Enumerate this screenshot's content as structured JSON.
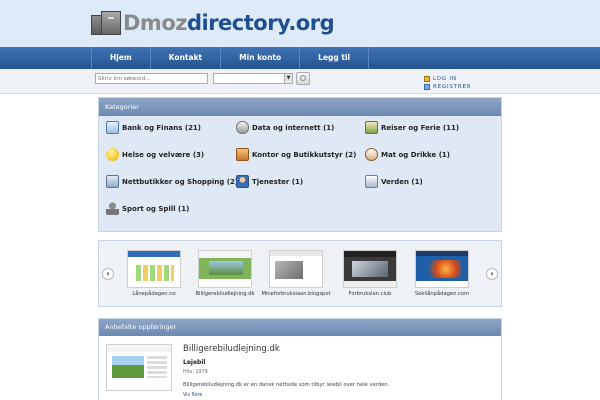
{
  "logo": {
    "part1": "Dmoz",
    "part2": "directory.org"
  },
  "nav": {
    "items": [
      "Hjem",
      "Kontakt",
      "Min konto",
      "Legg til"
    ]
  },
  "search": {
    "placeholder": "Skriv inn søkeord..."
  },
  "account": {
    "login": "LOG IN",
    "register": "REGISTRER"
  },
  "categories": {
    "heading": "Kategorier",
    "items": [
      {
        "label": "Bank og Finans (21)",
        "icon": "bank-icon"
      },
      {
        "label": "Data og internett (1)",
        "icon": "computer-mouse-icon"
      },
      {
        "label": "Reiser og Ferie (11)",
        "icon": "travel-icon"
      },
      {
        "label": "Helse og velvære (3)",
        "icon": "smiley-icon"
      },
      {
        "label": "Kontor og Butikkutstyr (2)",
        "icon": "office-box-icon"
      },
      {
        "label": "Mat og Drikke (1)",
        "icon": "coffee-cup-icon"
      },
      {
        "label": "Nettbutikker og Shopping (2)",
        "icon": "shopping-basket-icon"
      },
      {
        "label": "Tjenester (1)",
        "icon": "person-icon"
      },
      {
        "label": "Verden (1)",
        "icon": "building-icon"
      },
      {
        "label": "Sport og Spill (1)",
        "icon": "trophy-icon"
      }
    ]
  },
  "carousel": {
    "items": [
      {
        "label": "Lånepådagen.no"
      },
      {
        "label": "Billigerebiludlejning.dk"
      },
      {
        "label": "Mineforbrukslaan.blogspot"
      },
      {
        "label": "Forbrukslan.club"
      },
      {
        "label": "Sekilånpådagen.com"
      }
    ]
  },
  "featured": {
    "heading": "Anbefalte oppføringer",
    "title": "Billigerebiludlejning.dk",
    "subtitle": "Lejebil",
    "small": "Hits: 1979",
    "description": "Billigerebiludlejning.dk er en dansk nettside som tilbyr leiebil over hele verden.",
    "link": "Vis flere"
  },
  "colors": {
    "brand_blue": "#1f4f8f",
    "nav_blue": "#2f62a6",
    "panel_bg": "#dfe8f5"
  }
}
